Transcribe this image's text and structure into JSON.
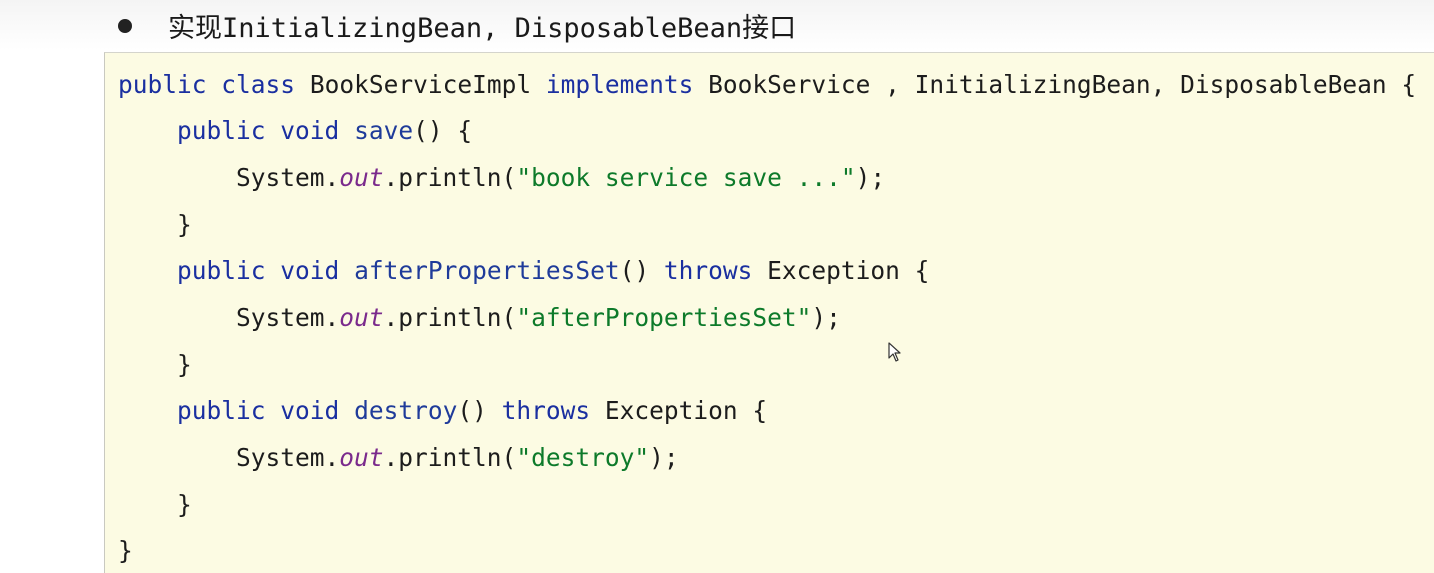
{
  "heading": {
    "text": "实现InitializingBean, DisposableBean接口"
  },
  "code": {
    "line1": {
      "kw1": "public",
      "kw2": "class",
      "name": "BookServiceImpl",
      "kw3": "implements",
      "rest": "BookService , InitializingBean, DisposableBean {"
    },
    "line2": {
      "kw1": "public",
      "kw2": "void",
      "fn": "save",
      "rest": "() {"
    },
    "line3": {
      "pre": "System.",
      "field": "out",
      "call": ".println(",
      "str": "\"book service save ...\"",
      "end": ");"
    },
    "line4": {
      "text": "}"
    },
    "line5": {
      "kw1": "public",
      "kw2": "void",
      "fn": "afterPropertiesSet",
      "mid": "() ",
      "kw3": "throws",
      "rest": " Exception {"
    },
    "line6": {
      "pre": "System.",
      "field": "out",
      "call": ".println(",
      "str": "\"afterPropertiesSet\"",
      "end": ");"
    },
    "line7": {
      "text": "}"
    },
    "line8": {
      "kw1": "public",
      "kw2": "void",
      "fn": "destroy",
      "mid": "() ",
      "kw3": "throws",
      "rest": " Exception {"
    },
    "line9": {
      "pre": "System.",
      "field": "out",
      "call": ".println(",
      "str": "\"destroy\"",
      "end": ");"
    },
    "line10": {
      "text": "}"
    },
    "line11": {
      "text": "}"
    }
  },
  "colors": {
    "keyword": "#1a2fa0",
    "string": "#0d7a2a",
    "static_field": "#7a2a8c",
    "code_background": "#fcfbe3"
  },
  "icons": {
    "bullet": "bullet-dot",
    "pointer": "mouse-pointer-icon"
  }
}
